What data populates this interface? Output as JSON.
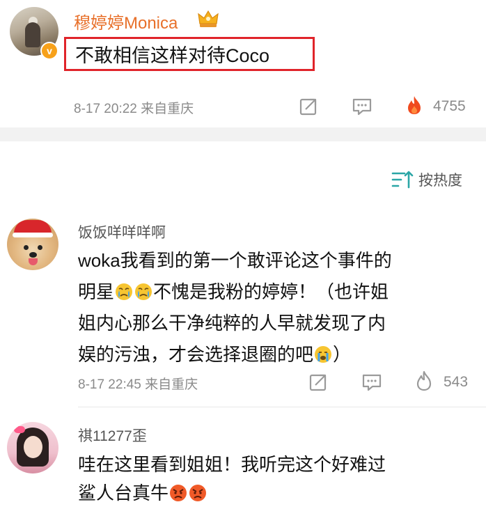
{
  "post": {
    "author": "穆婷婷Monica",
    "badge_letter": "v",
    "text": "不敢相信这样对待Coco",
    "meta": "8-17 20:22 来自重庆",
    "like_count": "4755",
    "icons": {
      "crown": "crown-icon",
      "share": "share-icon",
      "comment": "comment-icon",
      "like": "flame-icon"
    },
    "colors": {
      "author": "#e8702a",
      "highlight_box": "#e0242a",
      "flame": "#f04a1e"
    }
  },
  "sort": {
    "label": "按热度",
    "icon": "sort-icon"
  },
  "comments": [
    {
      "author": "饭饭咩咩咩啊",
      "lines": [
        "woka我看到的第一个敢评论这个事件的",
        "明星",
        "不愧是我粉的婷婷！（也许姐",
        "姐内心那么干净纯粹的人早就发现了内",
        "娱的污浊，才会选择退圈的吧",
        "）"
      ],
      "meta": "8-17 22:45 来自重庆",
      "like_count": "543",
      "emoji": [
        "crying-face-emoji",
        "crying-face-emoji",
        "sobbing-face-emoji"
      ]
    },
    {
      "author": "祺11277歪",
      "lines": [
        "哇在这里看到姐姐！我听完这个好难过",
        "鲨人台真牛"
      ],
      "emoji": [
        "angry-face-emoji",
        "angry-face-emoji"
      ]
    }
  ]
}
